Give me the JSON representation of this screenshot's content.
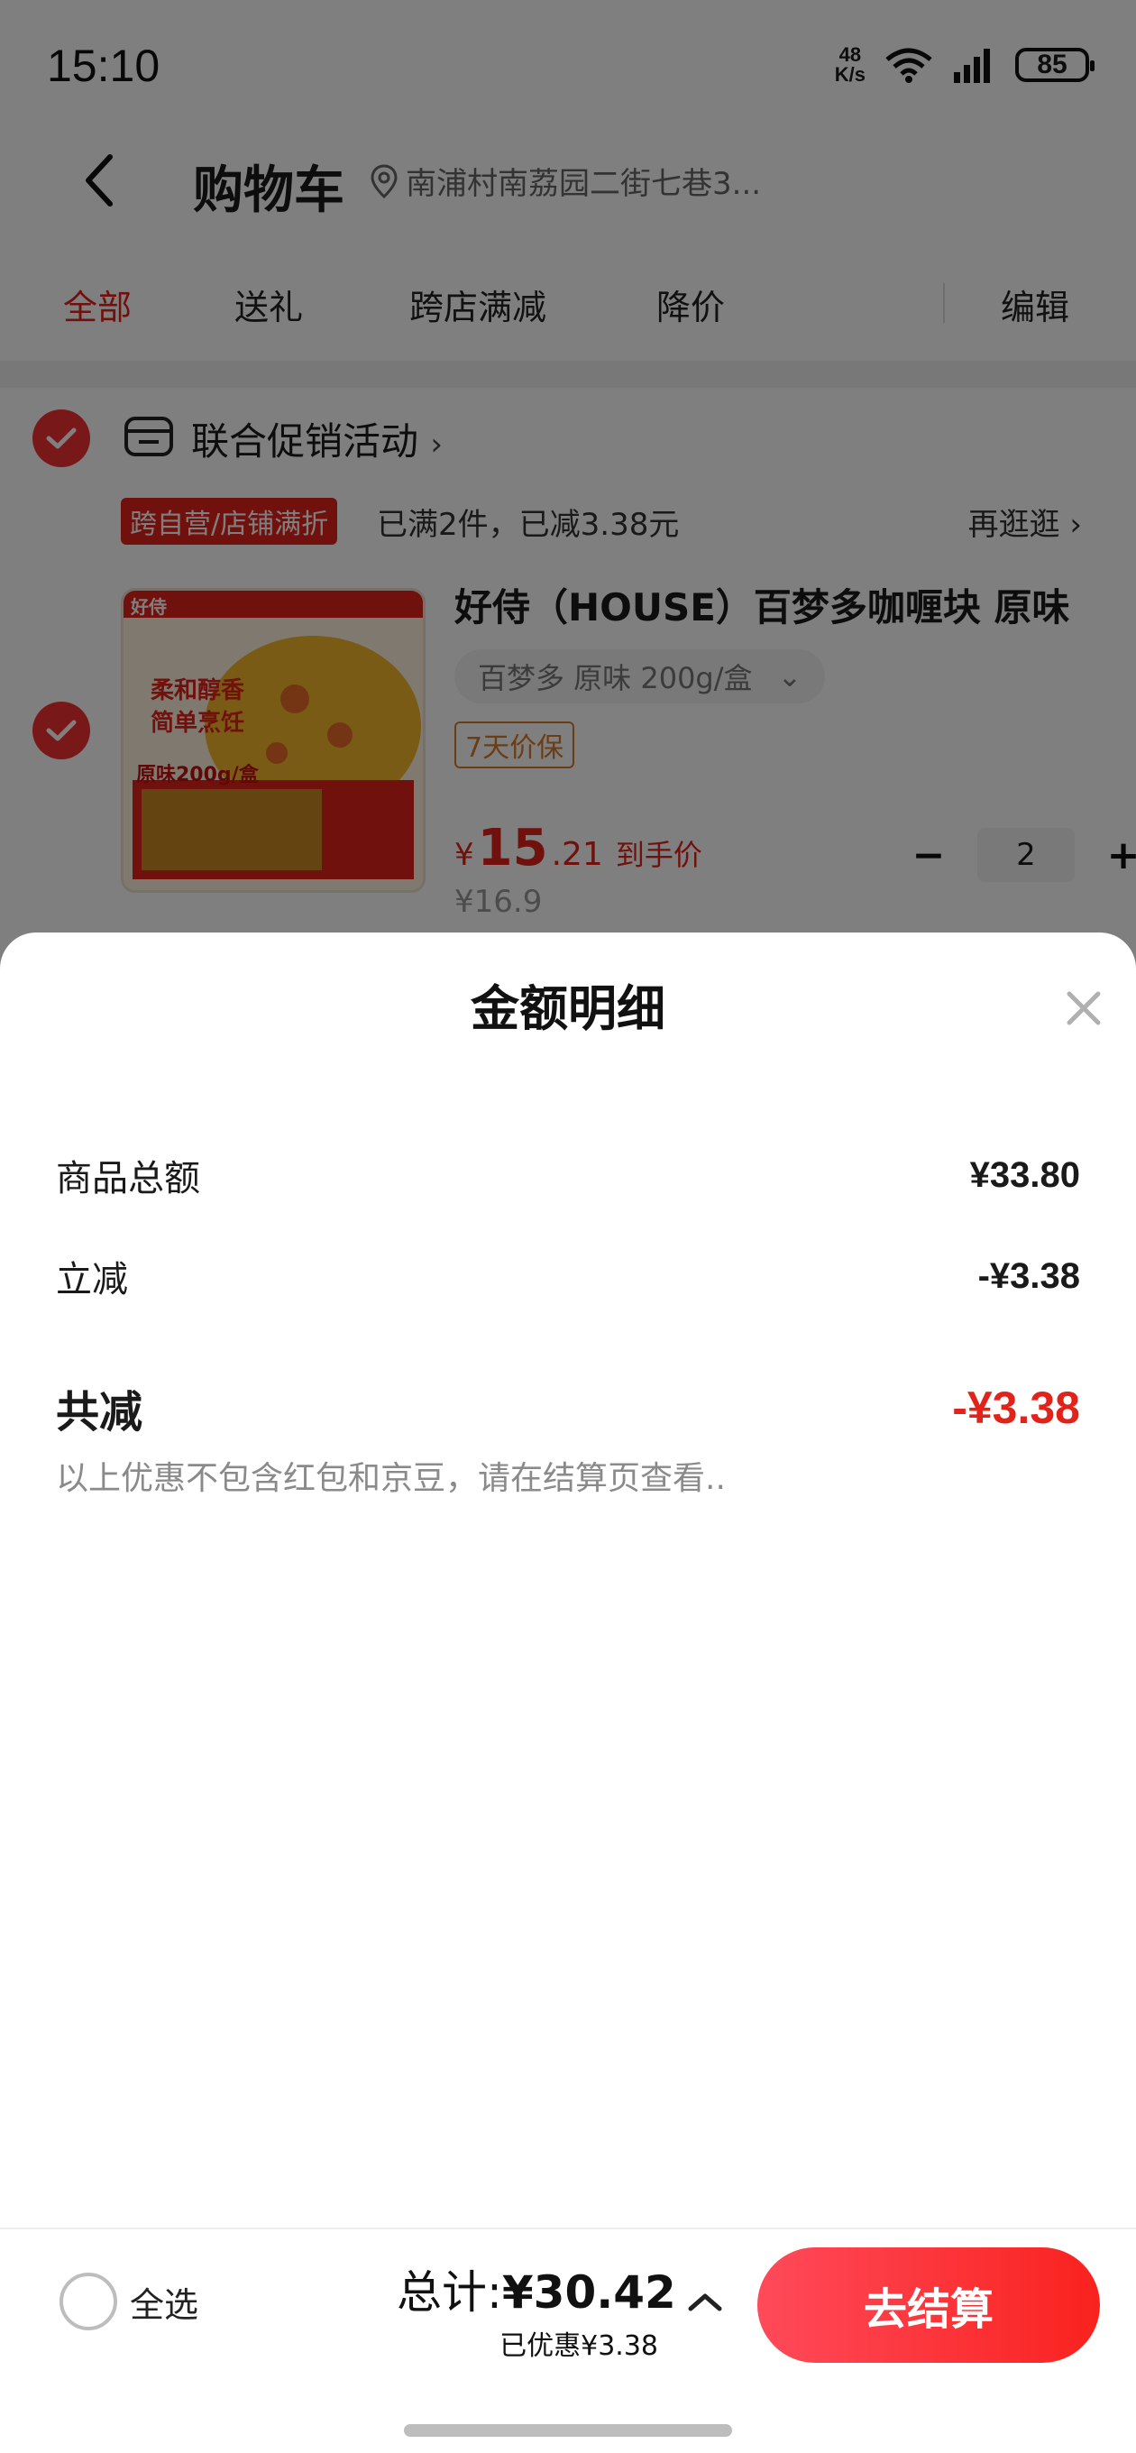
{
  "status_bar": {
    "time": "15:10",
    "net_speed_value": "48",
    "net_speed_unit": "K/s",
    "battery": "85"
  },
  "nav": {
    "title": "购物车",
    "address": "南浦村南荔园二街七巷3..."
  },
  "tabs": [
    {
      "label": "全部",
      "active": true
    },
    {
      "label": "送礼"
    },
    {
      "label": "跨店满减"
    },
    {
      "label": "降价"
    },
    {
      "label": "编辑"
    }
  ],
  "store": {
    "title": "联合促销活动",
    "chevron": "›"
  },
  "promo": {
    "tag": "跨自营/店铺满折",
    "text": "已满2件，已减3.38元",
    "more": "再逛逛 ›"
  },
  "product": {
    "name": "好侍（HOUSE）百梦多咖喱块 原味",
    "spec": "百梦多 原味 200g/盒",
    "spec_arrow": "⌄",
    "price_protect": "7天价保",
    "price_currency": "¥",
    "price_int": "15",
    "price_dec": ".21",
    "price_label": "到手价",
    "price_old": "¥16.9",
    "qty_minus": "−",
    "qty": "2",
    "qty_plus": "+",
    "image_text_brand": "好侍",
    "image_text_1": "柔和醇香",
    "image_text_2": "简单烹饪",
    "image_text_3": "原味200g/盒",
    "image_brand_colors": "#e2231a"
  },
  "sheet": {
    "title": "金额明细",
    "rows": [
      {
        "label": "商品总额",
        "value": "¥33.80"
      },
      {
        "label": "立减",
        "value": "-¥3.38"
      }
    ],
    "total_label": "共减",
    "total_value": "-¥3.38",
    "note": "以上优惠不包含红包和京豆，请在结算页查看.."
  },
  "bottom": {
    "select_all": "全选",
    "total_label": "总计:",
    "total_value": "¥30.42",
    "saved": "已优惠¥3.38",
    "checkout": "去结算"
  },
  "colors": {
    "accent": "#e2231a",
    "checkout_gradient_start": "#ff4a5a",
    "checkout_gradient_end": "#f9221e"
  },
  "icons": {
    "back": "back-arrow-icon",
    "location": "location-pin-icon",
    "store": "store-icon",
    "close": "close-icon",
    "chevron_up": "chevron-up-icon"
  }
}
